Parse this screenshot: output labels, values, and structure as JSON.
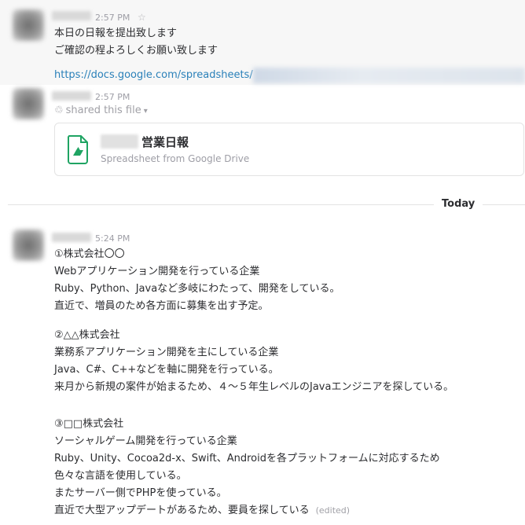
{
  "messages": [
    {
      "timestamp": "2:57 PM",
      "star_icon": "star-outline-icon",
      "lines": [
        "本日の日報を提出致します",
        "ご確認の程よろしくお願い致します"
      ],
      "link": "https://docs.google.com/spreadsheets/"
    },
    {
      "timestamp": "2:57 PM",
      "shared_text": "shared this file",
      "file": {
        "icon": "google-sheets-icon",
        "title": "営業日報",
        "subtitle": "Spreadsheet from Google Drive"
      }
    },
    {
      "timestamp": "5:24 PM",
      "lines": [
        "①株式会社〇〇",
        "Webアプリケーション開発を行っている企業",
        "Ruby、Python、Javaなど多岐にわたって、開発をしている。",
        "直近で、増員のため各方面に募集を出す予定。",
        "②△△株式会社",
        "業務系アプリケーション開発を主にしている企業",
        "Java、C#、C++などを軸に開発を行っている。",
        "来月から新規の案件が始まるため、４〜５年生レベルのJavaエンジニアを探している。",
        "③□□株式会社",
        "ソーシャルゲーム開発を行っている企業",
        "Ruby、Unity、Cocoa2d-x、Swift、Androidを各プラットフォームに対応するため",
        "色々な言語を使用している。",
        "またサーバー側でPHPを使っている。",
        "直近で大型アップデートがあるため、要員を探している"
      ],
      "edited": "(edited)"
    }
  ],
  "day_divider": "Today"
}
